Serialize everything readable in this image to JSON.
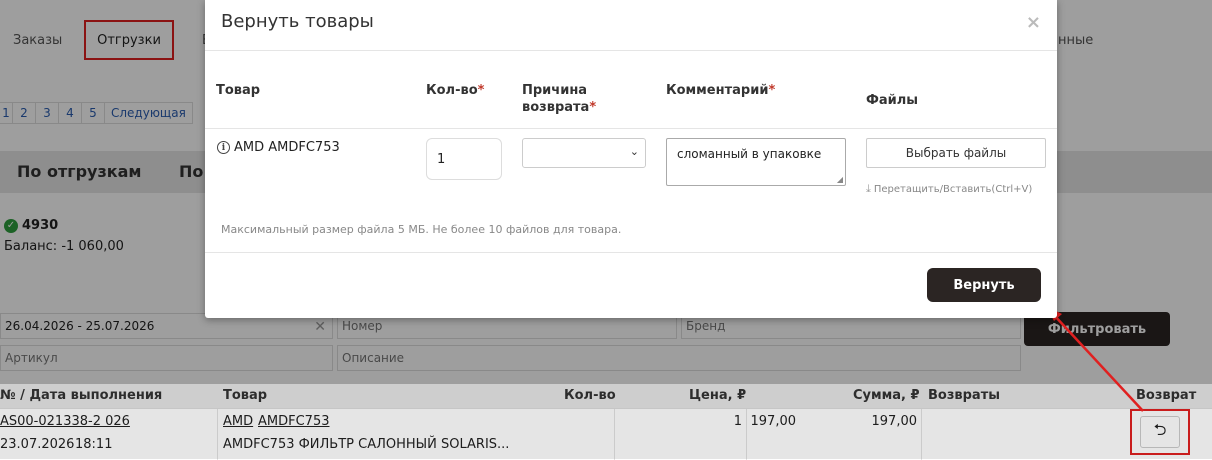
{
  "tabs": {
    "orders": "Заказы",
    "shipments": "Отгрузки",
    "partial_b": "В",
    "partial_right": "нные"
  },
  "pager": {
    "pages": [
      "1",
      "2",
      "3",
      "4",
      "5"
    ],
    "next": "Следующая"
  },
  "group": {
    "by_shipments": "По отгрузкам",
    "by_partial": "По"
  },
  "account": {
    "number": "4930",
    "balance": "Баланс: -1 060,00"
  },
  "filters": {
    "date_range": "26.04.2026 - 25.07.2026",
    "number_placeholder": "Номер",
    "brand_placeholder": "Бренд",
    "article_placeholder": "Артикул",
    "description_placeholder": "Описание",
    "filter_button": "Фильтровать"
  },
  "table": {
    "headers": {
      "num_date": "№ / Дата выполнения",
      "product": "Товар",
      "qty": "Кол-во",
      "price": "Цена, ₽",
      "sum": "Сумма, ₽",
      "returns": "Возвраты",
      "return": "Возврат"
    },
    "row": {
      "doc_number": "AS00-021338-2 026",
      "date": "23.07.2026",
      "time": "18:11",
      "brand": "AMD",
      "article": "AMDFC753",
      "description": "AMDFC753 ФИЛЬТР САЛОННЫЙ SOLARIS...",
      "qty": "1",
      "price": "197,00",
      "sum": "197,00"
    }
  },
  "modal": {
    "title": "Вернуть товары",
    "close": "×",
    "columns": {
      "product": "Товар",
      "qty": "Кол-во",
      "reason_line1": "Причина",
      "reason_line2": "возврата",
      "comment": "Комментарий",
      "files": "Файлы"
    },
    "required_mark": "*",
    "item": {
      "name": "AMD AMDFC753",
      "qty": "1",
      "comment": "сломанный в упаковке",
      "files_button": "Выбрать файлы",
      "drop_hint": "Перетащить/Вставить(Ctrl+V)"
    },
    "note": "Максимальный размер файла 5 МБ. Не более 10 файлов для товара.",
    "submit": "Вернуть"
  },
  "icons": {
    "check": "check-circle-icon",
    "info": "info-circle-icon",
    "return": "return-arrow-icon",
    "download": "download-icon"
  },
  "colors": {
    "accent_dark": "#2b2523",
    "highlight_red": "#e02020",
    "link": "#2a5db0",
    "required": "#c0392b"
  }
}
